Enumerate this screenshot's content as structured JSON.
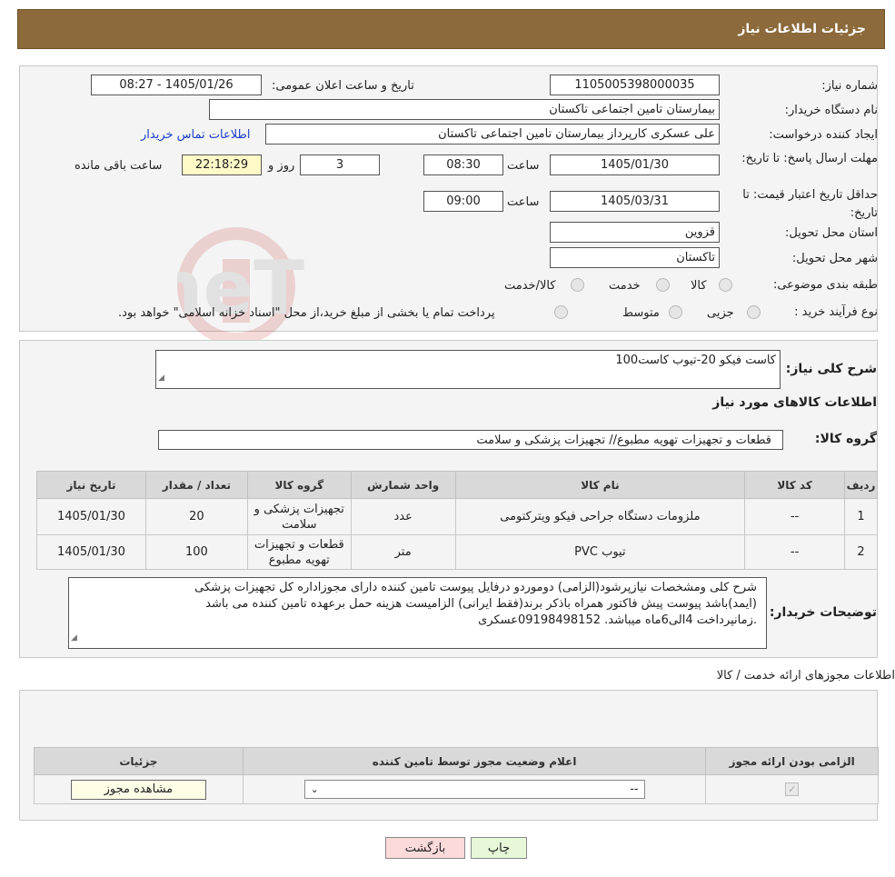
{
  "header": {
    "title": "جزئیات اطلاعات نیاز"
  },
  "form": {
    "need_number": {
      "label": "شماره نیاز:",
      "value": "1105005398000035"
    },
    "announce_datetime": {
      "label": "تاریخ و ساعت اعلان عمومی:",
      "value": "1405/01/26 - 08:27"
    },
    "buyer_org": {
      "label": "نام دستگاه خریدار:",
      "value": "بیمارستان تامین اجتماعی تاکستان"
    },
    "requester": {
      "label": "ایجاد کننده درخواست:",
      "value": "علی عسکری کارپرداز بیمارستان تامین اجتماعی تاکستان",
      "contact_link": "اطلاعات تماس خریدار"
    },
    "deadline": {
      "label": "مهلت ارسال پاسخ: تا تاریخ:",
      "date": "1405/01/30",
      "time_label": "ساعت",
      "time": "08:30",
      "days": "3",
      "days_label": "روز و",
      "remaining": "22:18:29",
      "remaining_label": "ساعت باقی مانده"
    },
    "validity": {
      "label": "حداقل تاریخ اعتبار قیمت: تا تاریخ:",
      "date": "1405/03/31",
      "time_label": "ساعت",
      "time": "09:00"
    },
    "province": {
      "label": "استان محل تحویل:",
      "value": "قزوین"
    },
    "city": {
      "label": "شهر محل تحویل:",
      "value": "تاکستان"
    },
    "category": {
      "label": "طبقه بندی موضوعی:",
      "options": [
        "کالا",
        "خدمت",
        "کالا/خدمت"
      ]
    },
    "process": {
      "label": "نوع فرآیند خرید :",
      "options": [
        "جزیی",
        "متوسط"
      ],
      "note": "پرداخت تمام یا بخشی از مبلغ خرید،از محل \"اسناد خزانه اسلامی\" خواهد بود."
    }
  },
  "description": {
    "label": "شرح کلی نیاز:",
    "value": "کاست فیکو 20-تیوب کاست100",
    "goods_info_title": "اطلاعات کالاهای مورد نیاز",
    "goods_group_label": "گروه کالا:",
    "goods_group_value": "قطعات و تجهیزات تهویه مطبوع// تجهیزات پزشکی و سلامت"
  },
  "goods_table": {
    "headers": [
      "ردیف",
      "کد کالا",
      "نام کالا",
      "واحد شمارش",
      "گروه کالا",
      "تعداد / مقدار",
      "تاریخ نیاز"
    ],
    "rows": [
      [
        "1",
        "--",
        "ملزومات دستگاه جراحی فیکو ویترکتومی",
        "عدد",
        "تجهیزات پزشکی و سلامت",
        "20",
        "1405/01/30"
      ],
      [
        "2",
        "--",
        "تیوب PVC",
        "متر",
        "قطعات و تجهیزات تهویه مطبوع",
        "100",
        "1405/01/30"
      ]
    ]
  },
  "buyer_notes": {
    "label": "توضیحات خریدار:",
    "lines": [
      "شرح کلی ومشخصات نیازپرشود(الزامی) دوموردو درفایل پیوست تامین کننده دارای مجوزاداره کل تجهیزات پزشکی",
      "(ایمد)باشد پیوست پیش فاکتور همراه باذکر برند(فقط ایرانی) الزامیست هزینه حمل برعهده تامین کننده می باشد",
      ".زمانپرداخت 4الی6ماه میباشد. 09198498152عسکری"
    ]
  },
  "permits": {
    "title": "اطلاعات مجوزهای ارائه خدمت / کالا",
    "headers": [
      "الزامی بودن ارائه مجوز",
      "اعلام وضعیت مجوز توسط تامین کننده",
      "جزئیات"
    ],
    "select_value": "--",
    "view_button": "مشاهده مجوز"
  },
  "buttons": {
    "print": "چاپ",
    "back": "بازگشت"
  },
  "watermark": {
    "text": "AriaTender.neT"
  },
  "colors": {
    "header_bg": "#8c6a3b",
    "panel_bg": "#f4f4f4",
    "yellow": "#fff9c8",
    "link": "#1a3ec9",
    "back_btn": "#fbdada",
    "print_btn": "#e6f8d8"
  }
}
